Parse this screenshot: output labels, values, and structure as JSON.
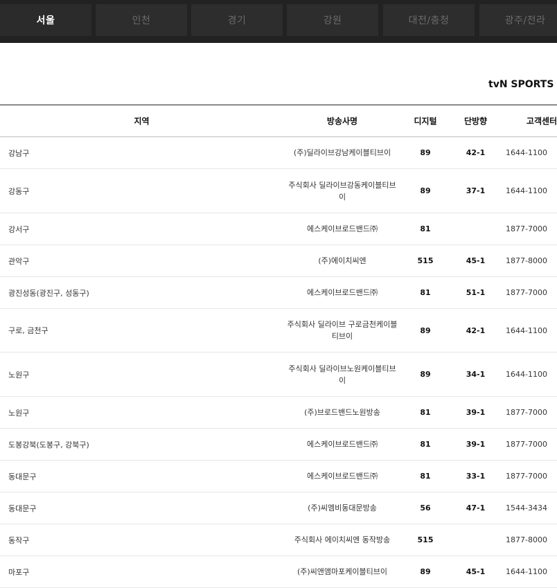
{
  "tabs": [
    {
      "label": "서울",
      "active": true
    },
    {
      "label": "인천",
      "active": false
    },
    {
      "label": "경기",
      "active": false
    },
    {
      "label": "강원",
      "active": false
    },
    {
      "label": "대전/충청",
      "active": false
    },
    {
      "label": "광주/전라",
      "active": false
    }
  ],
  "channel_select": {
    "label": "tvN SPORTS",
    "icon": "chevron-down-icon"
  },
  "table": {
    "headers": {
      "region": "지역",
      "company": "방송사명",
      "digital": "디지털",
      "one_way": "단방향",
      "service": "고객센터"
    },
    "rows": [
      {
        "region": "강남구",
        "company": "(주)딜라이브강남케이블티브이",
        "digital": "89",
        "one_way": "42-1",
        "phone": "1644-1100"
      },
      {
        "region": "강동구",
        "company": "주식회사 딜라이브강동케이블티브이",
        "digital": "89",
        "one_way": "37-1",
        "phone": "1644-1100"
      },
      {
        "region": "강서구",
        "company": "에스케이브로드밴드㈜",
        "digital": "81",
        "one_way": "",
        "phone": "1877-7000"
      },
      {
        "region": "관악구",
        "company": "(주)에이치씨엔",
        "digital": "515",
        "one_way": "45-1",
        "phone": "1877-8000"
      },
      {
        "region": "광진성동(광진구, 성동구)",
        "company": "에스케이브로드밴드㈜",
        "digital": "81",
        "one_way": "51-1",
        "phone": "1877-7000"
      },
      {
        "region": "구로, 금천구",
        "company": "주식회사 딜라이브 구로금천케이블티브이",
        "digital": "89",
        "one_way": "42-1",
        "phone": "1644-1100"
      },
      {
        "region": "노원구",
        "company": "주식회사 딜라이브노원케이블티브이",
        "digital": "89",
        "one_way": "34-1",
        "phone": "1644-1100"
      },
      {
        "region": "노원구",
        "company": "(주)브로드밴드노원방송",
        "digital": "81",
        "one_way": "39-1",
        "phone": "1877-7000"
      },
      {
        "region": "도봉강북(도봉구, 강북구)",
        "company": "에스케이브로드밴드㈜",
        "digital": "81",
        "one_way": "39-1",
        "phone": "1877-7000"
      },
      {
        "region": "동대문구",
        "company": "에스케이브로드밴드㈜",
        "digital": "81",
        "one_way": "33-1",
        "phone": "1877-7000"
      },
      {
        "region": "동대문구",
        "company": "(주)씨엠비동대문방송",
        "digital": "56",
        "one_way": "47-1",
        "phone": "1544-3434"
      },
      {
        "region": "동작구",
        "company": "주식회사 에이치씨엔 동작방송",
        "digital": "515",
        "one_way": "",
        "phone": "1877-8000"
      },
      {
        "region": "마포구",
        "company": "(주)씨앤앰마포케이블티브이",
        "digital": "89",
        "one_way": "45-1",
        "phone": "1644-1100"
      }
    ]
  }
}
